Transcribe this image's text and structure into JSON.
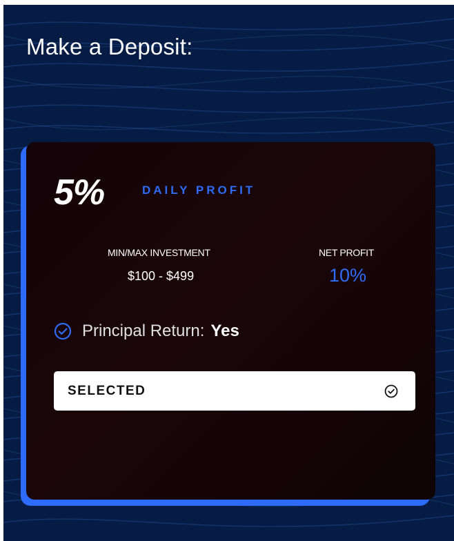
{
  "page": {
    "title": "Make a Deposit:"
  },
  "plan": {
    "rate": "5%",
    "rate_label": "DAILY PROFIT",
    "minmax_label": "MIN/MAX INVESTMENT",
    "minmax_value": "$100 - $499",
    "net_profit_label": "NET PROFIT",
    "net_profit_value": "10%",
    "principal_label": "Principal Return:",
    "principal_value": "Yes",
    "button_label": "SELECTED",
    "icons": {
      "principal": "check-circle-icon",
      "button": "check-circle-icon"
    }
  },
  "colors": {
    "background": "#071c44",
    "accent": "#2e6cf6",
    "card": "#120308",
    "button": "#ffffff"
  }
}
